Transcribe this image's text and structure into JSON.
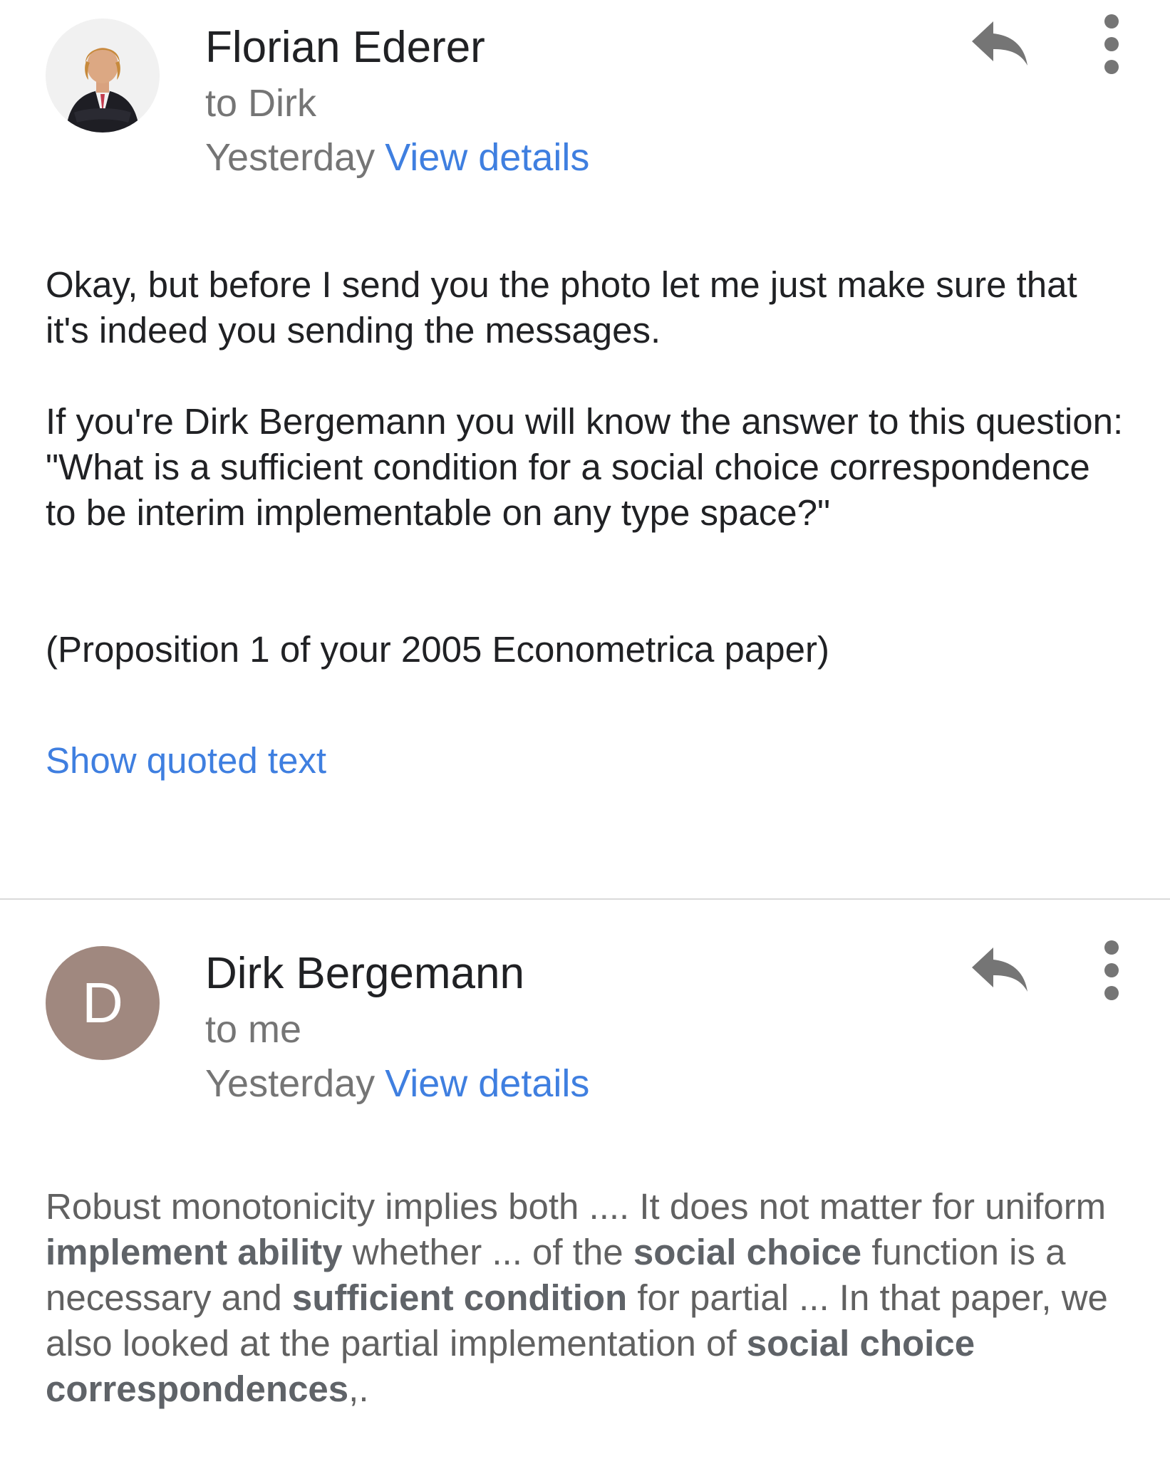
{
  "messages": [
    {
      "sender": "Florian Ederer",
      "recipient": "to Dirk",
      "date": "Yesterday",
      "details_link": "View details",
      "body": [
        "Okay, but before I send you the photo let me just make sure that it's indeed you sending the messages.",
        "If you're Dirk Bergemann you will know the answer to this question: \"What is a sufficient condition for a social choice correspondence to be interim implementable on any type space?\"",
        "(Proposition 1 of your 2005 Econometrica paper)"
      ],
      "quoted_link": "Show quoted text"
    },
    {
      "sender": "Dirk Bergemann",
      "avatar_letter": "D",
      "avatar_color": "#a0887f",
      "recipient": "to me",
      "date": "Yesterday",
      "details_link": "View details",
      "snippet": [
        {
          "t": "Robust monotonicity implies both .... It does not matter for uniform ",
          "b": false
        },
        {
          "t": "implement ability",
          "b": true
        },
        {
          "t": " whether ... of the ",
          "b": false
        },
        {
          "t": "social choice",
          "b": true
        },
        {
          "t": " function is a necessary and ",
          "b": false
        },
        {
          "t": "sufficient condition",
          "b": true
        },
        {
          "t": " for partial ... In that paper, we also looked at the partial implementation of ",
          "b": false
        },
        {
          "t": "social choice correspondences",
          "b": true
        },
        {
          "t": ",.",
          "b": false
        }
      ]
    }
  ],
  "colors": {
    "link": "#3f7fe0",
    "secondary_text": "#757575",
    "divider": "#dadada"
  },
  "icons": {
    "reply": "reply-arrow-icon",
    "more": "vertical-dots-icon"
  }
}
